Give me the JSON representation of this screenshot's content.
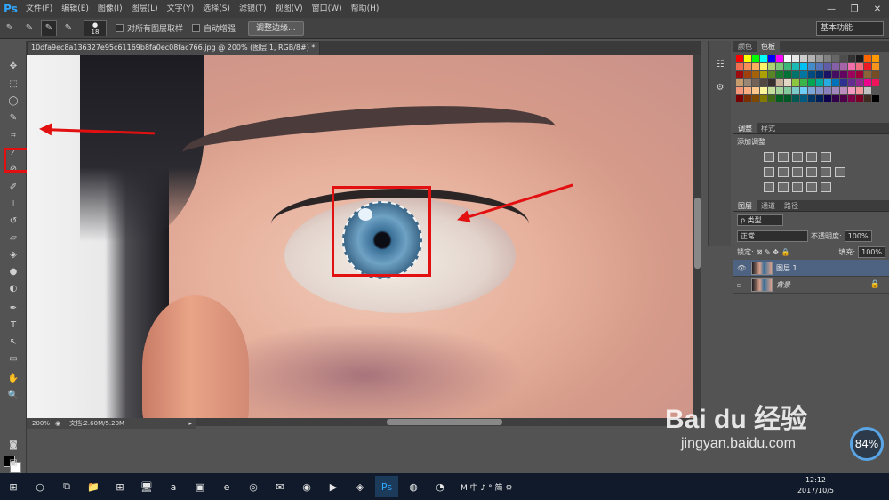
{
  "app": {
    "logo": "Ps",
    "title": "Adobe Photoshop"
  },
  "menu": [
    "文件(F)",
    "编辑(E)",
    "图像(I)",
    "图层(L)",
    "文字(Y)",
    "选择(S)",
    "滤镜(T)",
    "视图(V)",
    "窗口(W)",
    "帮助(H)"
  ],
  "window_controls": [
    "—",
    "❐",
    "✕"
  ],
  "options": {
    "brush_size": "18",
    "sample_all_layers": "对所有图层取样",
    "auto_enhance": "自动增强",
    "refine_edge": "调整边缘...",
    "workspace": "基本功能"
  },
  "document": {
    "tab_title": "10dfa9ec8a136327e95c61169b8fa0ec08fac766.jpg @ 200% (图层 1, RGB/8#) *",
    "zoom": "200%",
    "doc_info": "文档:2.60M/5.20M"
  },
  "panels": {
    "swatch_tabs": [
      "颜色",
      "色板"
    ],
    "adjust_tabs": [
      "调整",
      "样式"
    ],
    "adjust_title": "添加调整",
    "layer_tabs": [
      "图层",
      "通道",
      "路径"
    ],
    "kind": "ρ 类型",
    "blend_mode": "正常",
    "opacity_label": "不透明度:",
    "opacity": "100%",
    "lock_label": "锁定:",
    "fill_label": "填充:",
    "fill": "100%",
    "layers": [
      {
        "name": "图层 1",
        "selected": true
      },
      {
        "name": "背景",
        "selected": false
      }
    ]
  },
  "swatch_colors": [
    "#ff0000",
    "#ffff00",
    "#00ff00",
    "#00ffff",
    "#0000ff",
    "#ff00ff",
    "#ffffff",
    "#e6e6e6",
    "#cccccc",
    "#b3b3b3",
    "#999999",
    "#808080",
    "#666666",
    "#4d4d4d",
    "#333333",
    "#1a1a1a",
    "#ff6600",
    "#ff9900",
    "#f26c4f",
    "#f68e55",
    "#fbaf5c",
    "#fff467",
    "#acd372",
    "#7cc576",
    "#3bb878",
    "#1abbb4",
    "#00bff3",
    "#438ccb",
    "#5574b9",
    "#605ca8",
    "#855fa8",
    "#a763a8",
    "#f06ea9",
    "#f26d7d",
    "#ed1c24",
    "#f7941d",
    "#9e0b0f",
    "#a0410d",
    "#a36209",
    "#aba000",
    "#598527",
    "#1a7b30",
    "#007236",
    "#00746b",
    "#0076a3",
    "#004b80",
    "#003471",
    "#1b1464",
    "#440e62",
    "#630460",
    "#9e005d",
    "#9e0039",
    "#8c6239",
    "#754c24",
    "#c69c6d",
    "#998675",
    "#736357",
    "#534741",
    "#362f2d",
    "#c7b299",
    "#e2d6c4",
    "#8dc63f",
    "#39b54a",
    "#00a651",
    "#00a99d",
    "#29abe2",
    "#0072bc",
    "#2e3192",
    "#662d91",
    "#92278f",
    "#ec008c",
    "#ed145b",
    "#f7977a",
    "#f9ad81",
    "#fdc68a",
    "#fff799",
    "#c4df9b",
    "#a3d39c",
    "#82ca9c",
    "#7accc8",
    "#6dcff6",
    "#7da7d9",
    "#8393ca",
    "#8781bd",
    "#a186be",
    "#bd8cbf",
    "#f49ac1",
    "#f5989d",
    "#c2c2c2",
    "#555555",
    "#790000",
    "#7b2e00",
    "#7d4900",
    "#827b00",
    "#406618",
    "#005e20",
    "#005826",
    "#005952",
    "#005b7f",
    "#003663",
    "#002157",
    "#0d004c",
    "#32004b",
    "#4b0049",
    "#7b0046",
    "#7a0026",
    "#3d2b1f",
    "#000000"
  ],
  "taskbar": {
    "start": "⊞",
    "icons": [
      "○",
      "⧉",
      "📁",
      "⊞",
      "🖥",
      "a",
      "▣",
      "e",
      "◎",
      "✉",
      "◉",
      "▶",
      "◈",
      "Ps",
      "◍",
      "◔"
    ],
    "tray": "M 中 ♪ ° 简 ⚙",
    "time": "12:12",
    "date": "2017/10/5"
  },
  "watermark": {
    "main": "Bai du 经验",
    "sub": "jingyan.baidu.com"
  },
  "perf_badge": "84%"
}
